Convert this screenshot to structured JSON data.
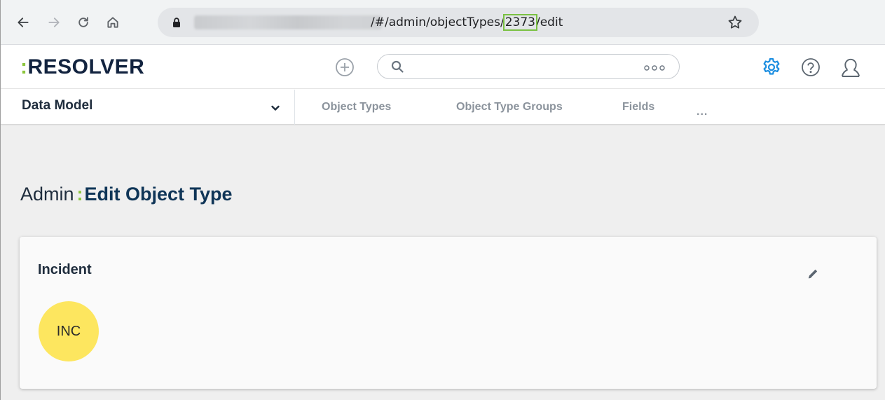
{
  "browser": {
    "url_suffix_before": "/#/admin/objectTypes/",
    "url_id": "2373",
    "url_suffix_after": "/edit"
  },
  "header": {
    "logo_colon": ":",
    "logo_text": "RESOLVER",
    "accent_color": "#8dc63f",
    "active_icon_color": "#1e8fe1"
  },
  "subnav": {
    "section_label": "Data Model",
    "tabs": [
      {
        "label": "Object Types"
      },
      {
        "label": "Object Type Groups"
      },
      {
        "label": "Fields"
      }
    ],
    "more_label": "..."
  },
  "page": {
    "title_prefix": "Admin",
    "title_separator": ":",
    "title_main": "Edit Object Type"
  },
  "card": {
    "name": "Incident",
    "badge_text": "INC",
    "badge_color": "#fde65f"
  }
}
